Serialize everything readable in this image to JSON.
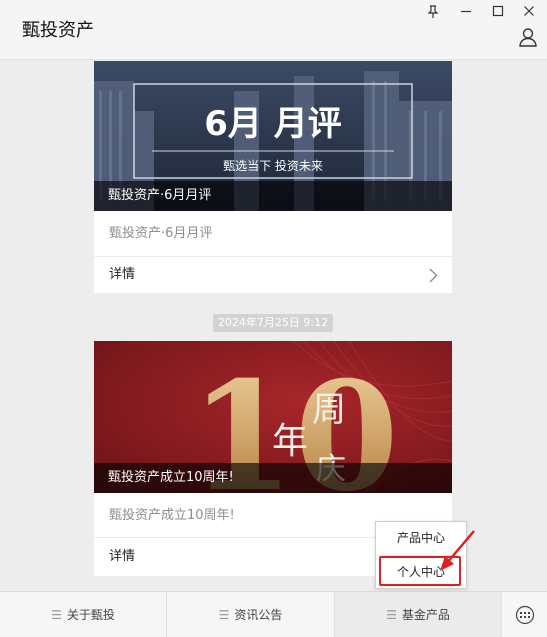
{
  "window": {
    "title": "甄投资产",
    "pin_icon": "pin-icon",
    "minimize_icon": "minimize-icon",
    "maximize_icon": "maximize-icon",
    "close_icon": "close-icon",
    "user_icon": "user-icon"
  },
  "cards": [
    {
      "banner_heading": "6月  月评",
      "banner_tagline": "甄选当下  投资未来",
      "caption": "甄投资产·6月月评",
      "description": "甄投资产·6月月评",
      "detail_label": "详情"
    },
    {
      "banner_number": "10",
      "banner_script": "年",
      "banner_script2": "周",
      "banner_script3": "庆",
      "caption": "甄投资产成立10周年!",
      "description": "甄投资产成立10周年!",
      "detail_label": "详情"
    }
  ],
  "timestamp": "2024年7月25日 9:12",
  "bottom_nav": [
    {
      "label": "关于甄投",
      "icon": "menu-icon"
    },
    {
      "label": "资讯公告",
      "icon": "menu-icon"
    },
    {
      "label": "基金产品",
      "icon": "menu-icon",
      "active": true
    }
  ],
  "keyboard_icon": "keyboard-icon",
  "popup_menu": [
    {
      "label": "产品中心"
    },
    {
      "label": "个人中心",
      "highlighted": true
    }
  ],
  "colors": {
    "highlight": "#e01f1f",
    "banner1": "#2d3a52",
    "banner2": "#8e1c1c",
    "gold": "#d9b27a"
  }
}
